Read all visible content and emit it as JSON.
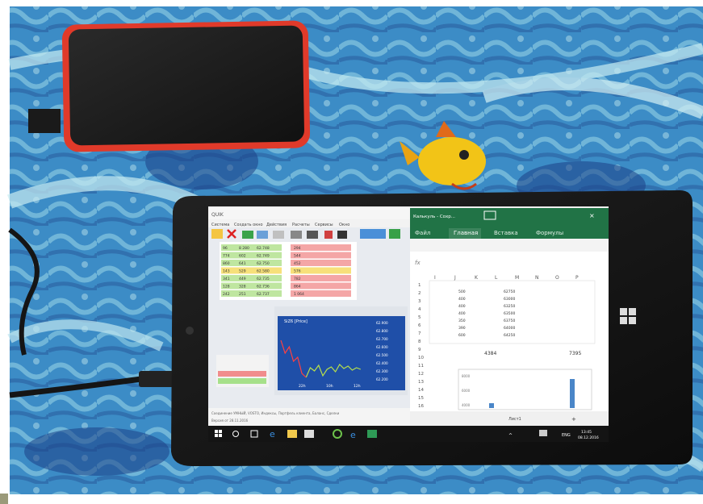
{
  "quik": {
    "title": "QUIK",
    "menu": [
      "Система",
      "Создать окно",
      "Действия",
      "Расчеты",
      "Сервисы",
      "Окно"
    ],
    "chart_label": "SiZ6 [Price]",
    "price_labels": [
      "62.900",
      "62.800",
      "62.700",
      "62.600",
      "62.500",
      "62.400",
      "62.300",
      "62.200"
    ],
    "time_labels": [
      "22h",
      "10h",
      "12h"
    ],
    "status_bar": "Соединение УМНЫЙ, VOSTO, Индексы, Портфель клиента, Баланс, Сделки",
    "status_bar_2": "Версия от 28.11.2016",
    "depth_rows": [
      {
        "bid": "96",
        "qty": "8 280",
        "px": "62.748"
      },
      {
        "bid": "774",
        "qty": "602",
        "px": "62.749"
      },
      {
        "bid": "860",
        "qty": "641",
        "px": "62.750"
      },
      {
        "bid": "143",
        "qty": "529",
        "px": "62.580"
      },
      {
        "bid": "341",
        "qty": "449",
        "px": "62.735"
      },
      {
        "bid": "128",
        "qty": "328",
        "px": "62.736"
      },
      {
        "bid": "242",
        "qty": "251",
        "px": "62.737"
      }
    ],
    "ask_rows": [
      "294",
      "544",
      "452",
      "576",
      "782",
      "864",
      "1 064"
    ]
  },
  "excel": {
    "title": "Калькуль - Сохр...",
    "tabs": [
      "Файл",
      "Главная",
      "Вставка",
      "Формулы"
    ],
    "formula_prefix": "fx",
    "col_headers": [
      "I",
      "J",
      "K",
      "L",
      "M",
      "N",
      "O",
      "P"
    ],
    "row_numbers": [
      "1",
      "2",
      "3",
      "4",
      "5",
      "6",
      "7",
      "8",
      "9",
      "10",
      "11",
      "12",
      "13",
      "14",
      "15",
      "16"
    ],
    "cells": {
      "k_values": [
        "500",
        "400",
        "400",
        "400",
        "350",
        "390",
        "600"
      ],
      "m_values": [
        "62750",
        "63000",
        "63250",
        "63500",
        "63750",
        "64000",
        "64250"
      ],
      "sum_left": "4384",
      "sum_right": "7395"
    },
    "chart_axis": [
      "8000",
      "6000",
      "4000"
    ],
    "sheet_tab": "Лист1",
    "sheet_add": "+"
  },
  "taskbar": {
    "time": "13:45",
    "date": "08.12.2016",
    "lang": "ENG"
  },
  "colors": {
    "carpet": "#3d8fc4",
    "excel_green": "#217346",
    "chart_bg": "#1f4fa8",
    "drive_red": "#e03a2a"
  }
}
